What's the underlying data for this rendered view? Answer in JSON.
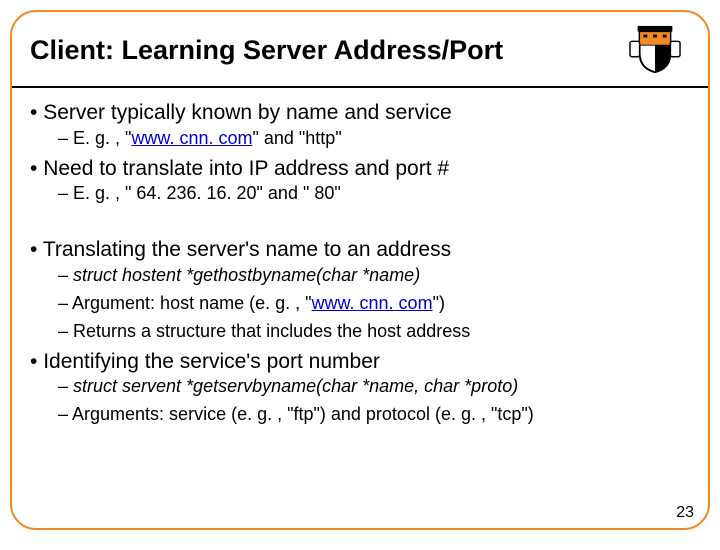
{
  "title": "Client: Learning Server Address/Port",
  "b1": "Server typically known by name and service",
  "b1s1_pre": "– E. g. , \"",
  "b1s1_link": "www. cnn. com",
  "b1s1_post": "\" and \"http\"",
  "b2": "Need to translate into IP address and port #",
  "b2s1": "– E. g. , \" 64. 236. 16. 20\" and \" 80\"",
  "b3": "Translating the server's name to an address",
  "b3s1": "– struct hostent *gethostbyname(char *name)",
  "b3s2_pre": "– Argument: host name (e. g. , \"",
  "b3s2_link": "www. cnn. com",
  "b3s2_post": "\")",
  "b3s3": "– Returns a structure that includes the host address",
  "b4": "Identifying the service's port number",
  "b4s1": "– struct servent *getservbyname(char *name, char *proto)",
  "b4s2": "– Arguments: service (e. g. , \"ftp\") and protocol (e. g. , \"tcp\")",
  "page": "23"
}
